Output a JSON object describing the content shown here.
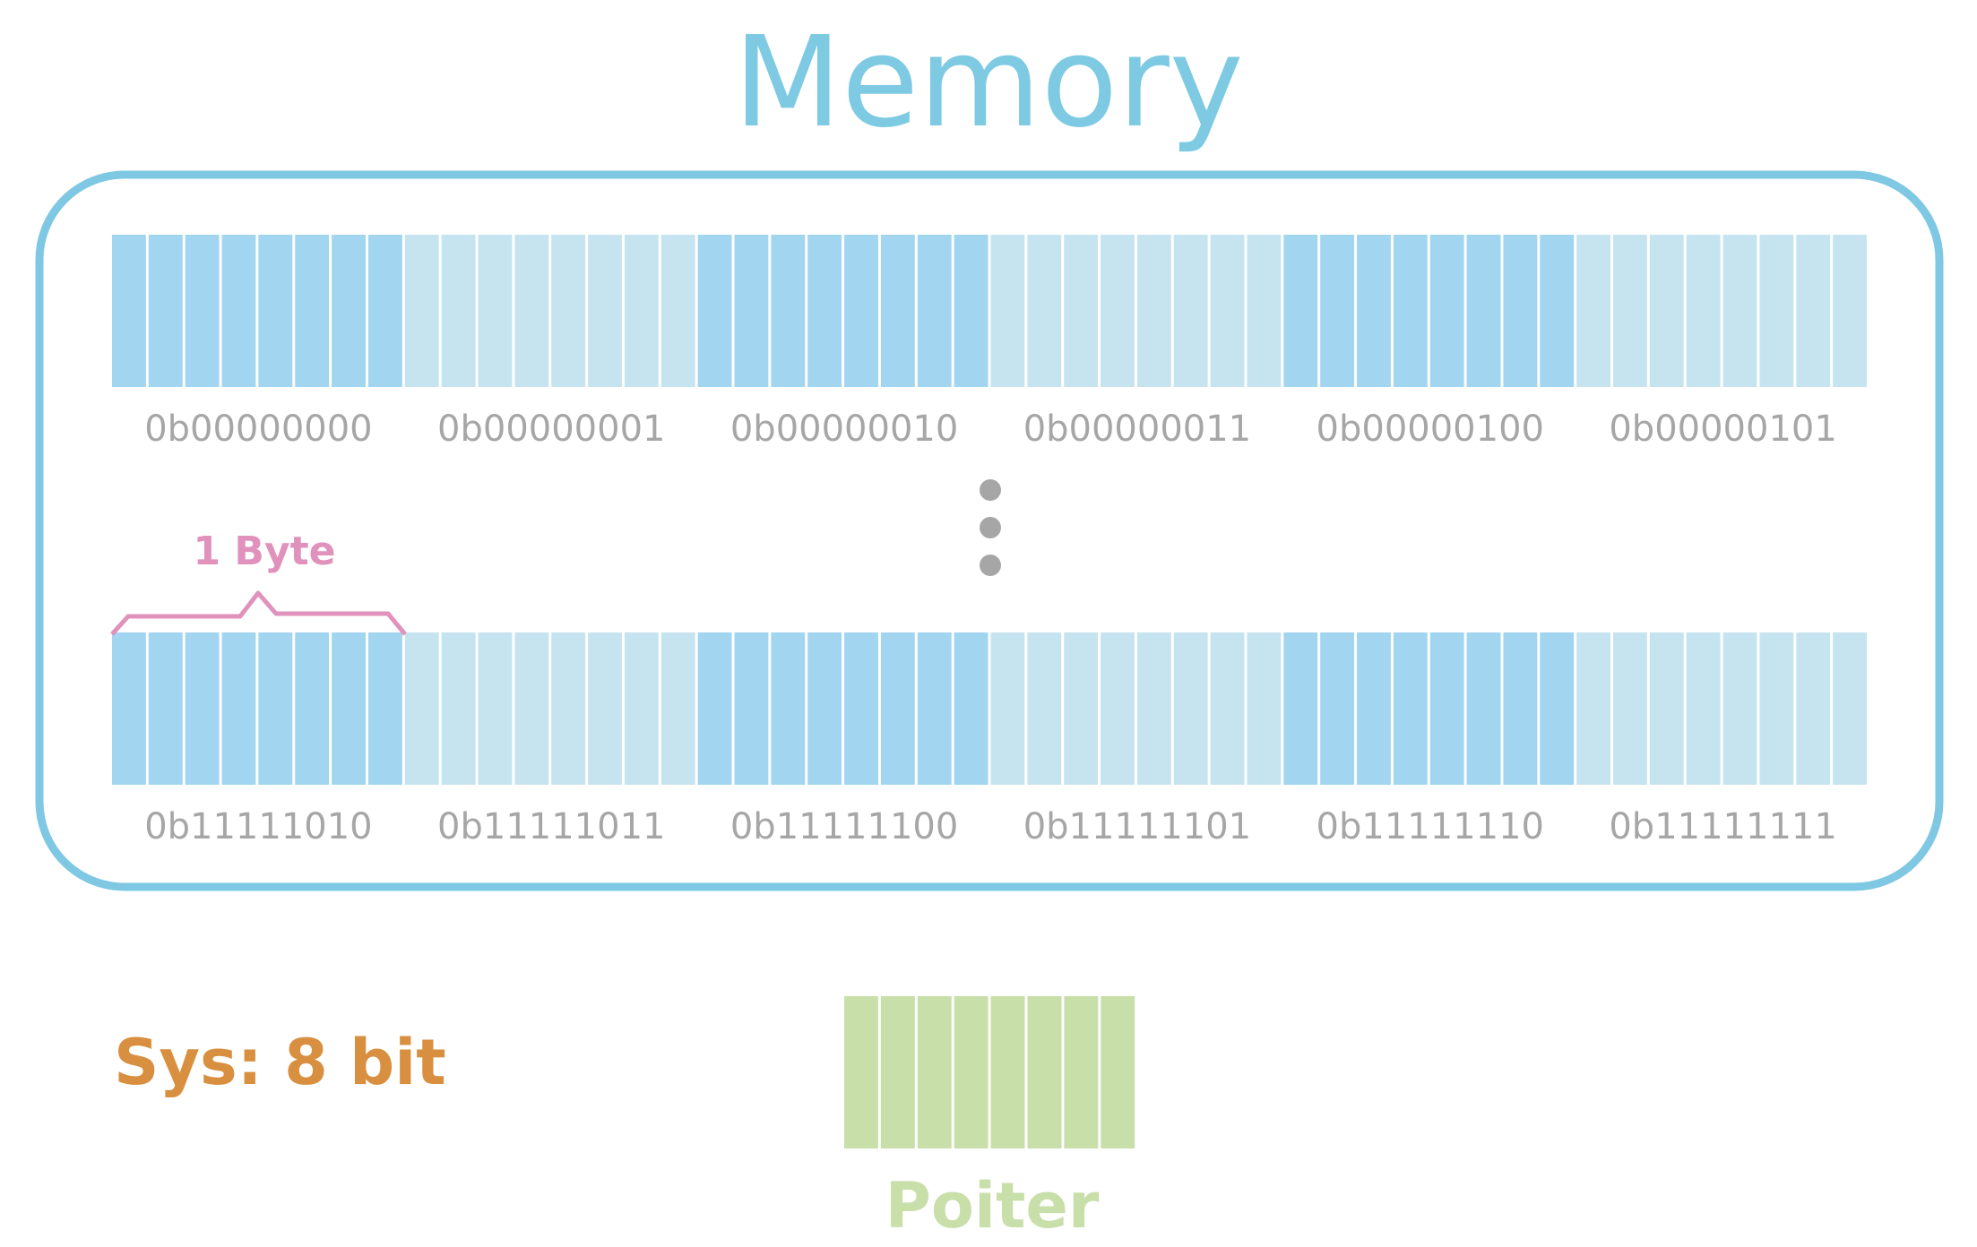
{
  "title": "Memory",
  "byte_label": "1 Byte",
  "system_label": "Sys: 8 bit",
  "pointer_label": "Poiter",
  "bits_per_byte": 8,
  "bytes_per_row": 6,
  "rows": [
    {
      "name": "top-row",
      "addresses": [
        "0b00000000",
        "0b00000001",
        "0b00000010",
        "0b00000011",
        "0b00000100",
        "0b00000101"
      ]
    },
    {
      "name": "bottom-row",
      "addresses": [
        "0b11111010",
        "0b11111011",
        "0b11111100",
        "0b11111101",
        "0b11111110",
        "0b11111111"
      ]
    }
  ],
  "ellipsis_dots": 3,
  "colors": {
    "title": "#7ecae3",
    "frame": "#7ec8e3",
    "byte_dark": "#a1d5f0",
    "byte_light": "#c6e4f0",
    "address_text": "#a6a6a6",
    "ellipsis": "#a6a6a6",
    "byte_bracket": "#e092bc",
    "system_text": "#d89040",
    "pointer_fill": "#c8dfaa",
    "pointer_text": "#c8dfaa"
  }
}
